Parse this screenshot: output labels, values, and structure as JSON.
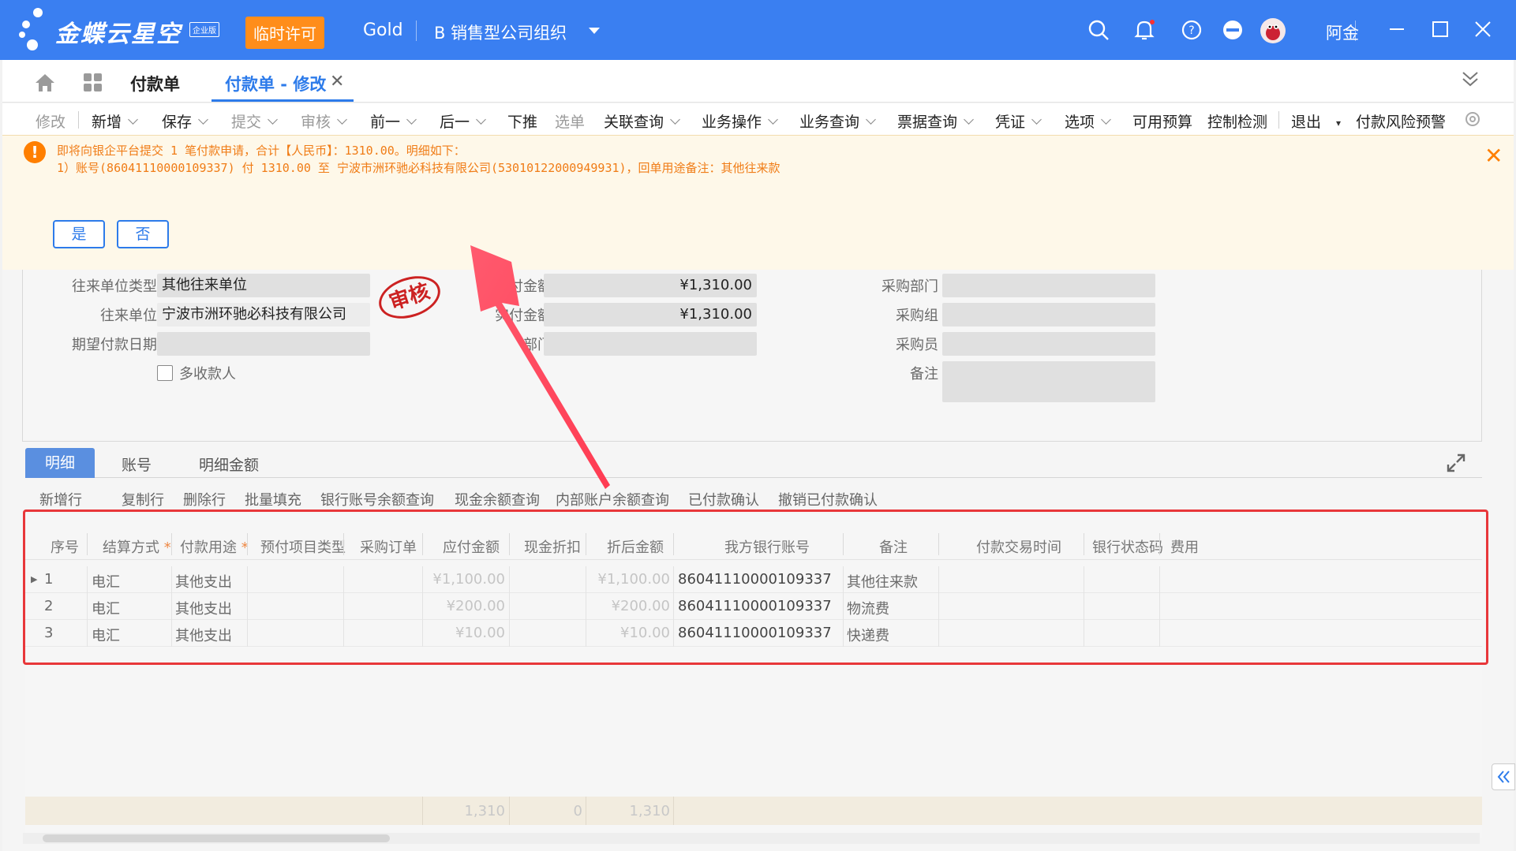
{
  "app": {
    "brand": "金蝶云星空",
    "edition_badge": "企业版",
    "license_badge": "临时许可",
    "edition": "Gold",
    "org": "B  销售型公司组织",
    "user": "阿金"
  },
  "tabs": {
    "list_label": "付款单",
    "active_label": "付款单 - 修改"
  },
  "toolbar": {
    "items": [
      {
        "label": "修改",
        "disabled": true
      },
      {
        "label": "新增"
      },
      {
        "label": "保存"
      },
      {
        "label": "提交",
        "disabled": true
      },
      {
        "label": "审核",
        "disabled": true
      },
      {
        "label": "前一"
      },
      {
        "label": "后一"
      },
      {
        "label": "下推"
      },
      {
        "label": "选单",
        "disabled": true
      },
      {
        "label": "关联查询"
      },
      {
        "label": "业务操作"
      },
      {
        "label": "业务查询"
      },
      {
        "label": "票据查询"
      },
      {
        "label": "凭证"
      },
      {
        "label": "选项"
      },
      {
        "label": "可用预算"
      },
      {
        "label": "控制检测"
      },
      {
        "label": "退出"
      },
      {
        "label": "付款风险预警"
      }
    ]
  },
  "notification": {
    "line1": "即将向银企平台提交 1 笔付款申请，合计【人民币】：1310.00。明细如下：",
    "line2": "1）账号(86041110000109337) 付 1310.00 至 宁波市洲环驰必科技有限公司(53010122000949931)，回单用途备注：其他往来款",
    "yes_label": "是",
    "no_label": "否"
  },
  "form": {
    "partner_type_label": "往来单位类型",
    "partner_type_value": "其他往来单位",
    "partner_label": "往来单位",
    "partner_value": "宁波市洲环驰必科技有限公司",
    "expected_date_label": "期望付款日期",
    "expected_date_value": "",
    "multi_payee_label": "多收款人",
    "stamp_text": "审核",
    "payable_label": "应付金额",
    "payable_value": "¥1,310.00",
    "actual_label": "实付金额",
    "actual_value": "¥1,310.00",
    "dept_label": "部门",
    "dept_value": "",
    "purchase_dept_label": "采购部门",
    "purchase_group_label": "采购组",
    "purchaser_label": "采购员",
    "remark_label": "备注"
  },
  "subtabs": {
    "detail": "明细",
    "account": "账号",
    "detail_amount": "明细金额"
  },
  "row_actions": [
    "新增行",
    "复制行",
    "删除行",
    "批量填充",
    "银行账号余额查询",
    "现金余额查询",
    "内部账户余额查询",
    "已付款确认",
    "撤销已付款确认"
  ],
  "grid": {
    "headers": [
      "序号",
      "结算方式",
      "付款用途",
      "预付项目类型",
      "采购订单",
      "应付金额",
      "现金折扣",
      "折后金额",
      "我方银行账号",
      "备注",
      "付款交易时间",
      "银行状态码",
      "费用"
    ],
    "rows": [
      {
        "seq": "1",
        "method": "电汇",
        "purpose": "其他支出",
        "payable": "¥1,100.00",
        "after": "¥1,100.00",
        "account": "86041110000109337",
        "remark": "其他往来款"
      },
      {
        "seq": "2",
        "method": "电汇",
        "purpose": "其他支出",
        "payable": "¥200.00",
        "after": "¥200.00",
        "account": "86041110000109337",
        "remark": "物流费"
      },
      {
        "seq": "3",
        "method": "电汇",
        "purpose": "其他支出",
        "payable": "¥10.00",
        "after": "¥10.00",
        "account": "86041110000109337",
        "remark": "快递费"
      }
    ],
    "totals": {
      "payable": "1,310",
      "discount": "0",
      "after": "1,310"
    }
  },
  "colors": {
    "brand_blue": "#3a7ff1",
    "warning_orange": "#f07c16",
    "highlight_red": "#e8373a"
  }
}
